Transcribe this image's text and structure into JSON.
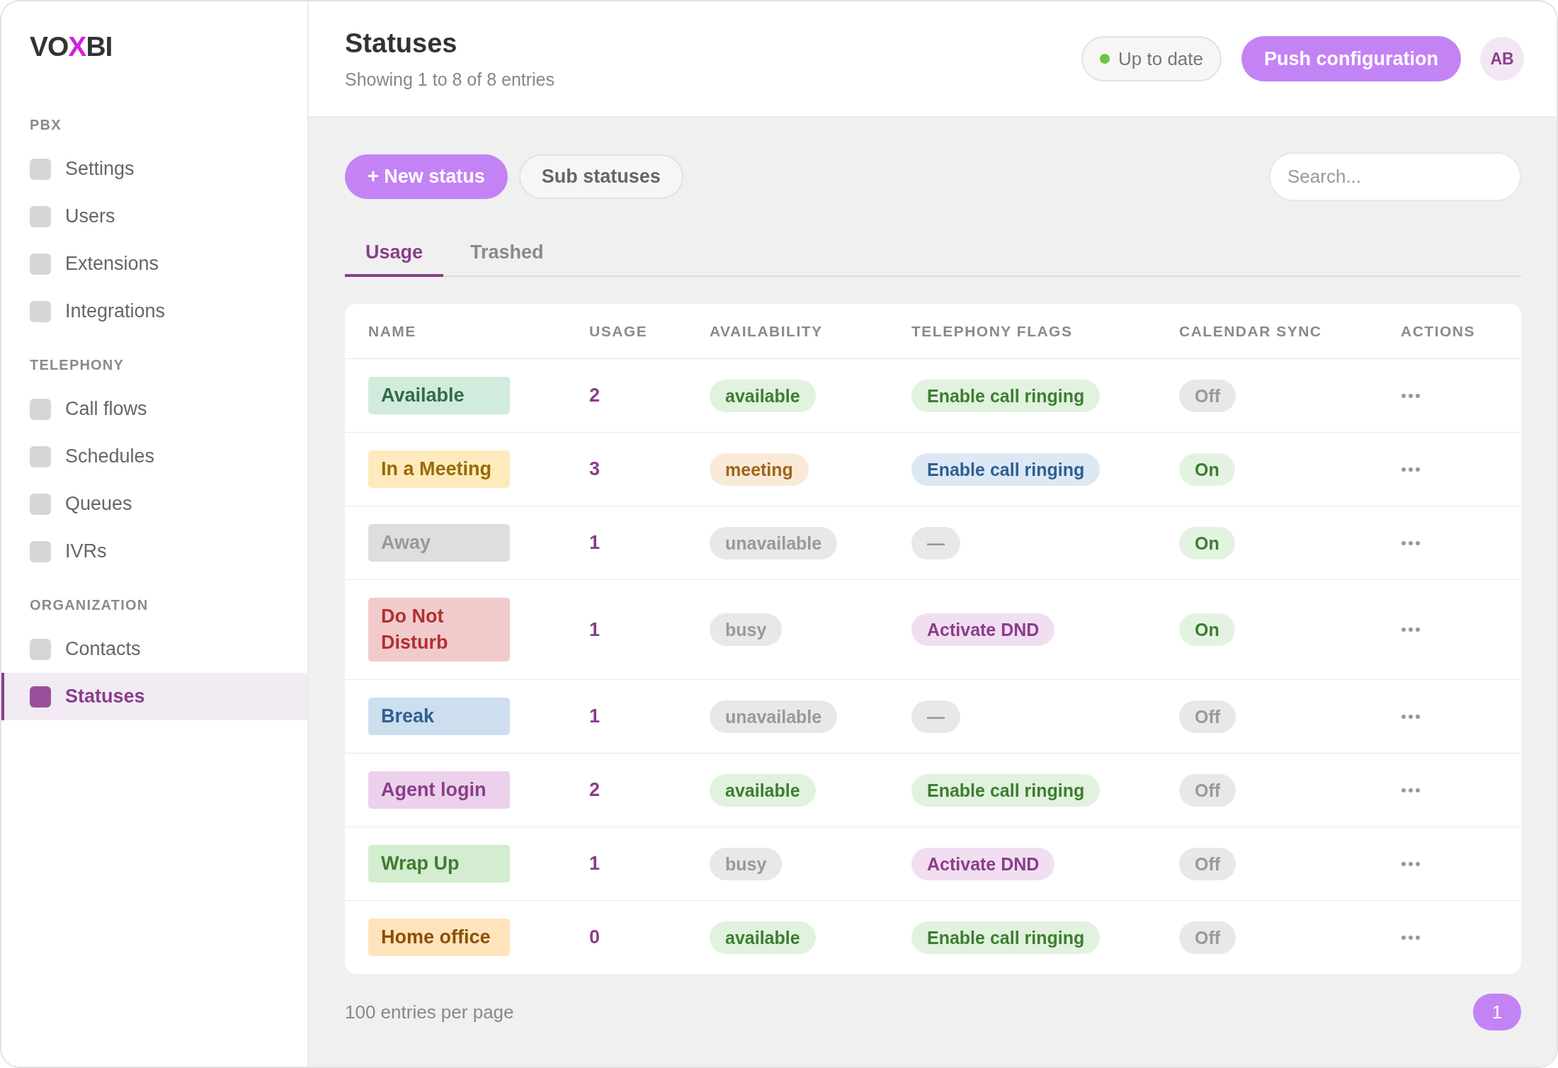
{
  "sidebar": {
    "logo": {
      "before": "VO",
      "accent": "X",
      "after": "BI"
    },
    "sections": [
      {
        "title": "PBX",
        "items": [
          {
            "label": "Settings",
            "selected": false
          },
          {
            "label": "Users",
            "selected": false
          },
          {
            "label": "Extensions",
            "selected": false
          },
          {
            "label": "Integrations",
            "selected": false
          }
        ]
      },
      {
        "title": "TELEPHONY",
        "items": [
          {
            "label": "Call flows",
            "selected": false
          },
          {
            "label": "Schedules",
            "selected": false
          },
          {
            "label": "Queues",
            "selected": false
          },
          {
            "label": "IVRs",
            "selected": false
          }
        ]
      },
      {
        "title": "ORGANIZATION",
        "items": [
          {
            "label": "Contacts",
            "selected": false
          },
          {
            "label": "Statuses",
            "selected": true
          }
        ]
      }
    ]
  },
  "header": {
    "title": "Statuses",
    "subtitle": "Showing 1 to 8 of 8 entries",
    "sync_status": {
      "text": "Up to date",
      "color": "#6bc646"
    },
    "push_button": "Push configuration",
    "avatar": "AB"
  },
  "toolbar": {
    "buttons": [
      {
        "label": "+ New status",
        "kind": "primary"
      },
      {
        "label": "Sub statuses",
        "kind": "secondary"
      }
    ],
    "search": {
      "placeholder": "Search..."
    }
  },
  "tabs": [
    {
      "label": "Usage",
      "selected": true
    },
    {
      "label": "Trashed",
      "selected": false
    }
  ],
  "table": {
    "columns": [
      "NAME",
      "USAGE",
      "AVAILABILITY",
      "TELEPHONY FLAGS",
      "CALENDAR SYNC",
      "ACTIONS"
    ],
    "rows": [
      {
        "name": {
          "text": "Available",
          "color": "#2e6b4a"
        },
        "usage": "2",
        "availability": {
          "text": "available",
          "color": "#3d7d32"
        },
        "telephony_flags": {
          "text": "Enable call ringing",
          "color": "#3d7d32"
        },
        "calendar_sync": {
          "text": "Off",
          "on": false
        }
      },
      {
        "name": {
          "text": "In a Meeting",
          "color": "#9a6a00"
        },
        "usage": "3",
        "availability": {
          "text": "meeting",
          "color": "#a0651a"
        },
        "telephony_flags": {
          "text": "Enable call ringing",
          "color": "#2f5f8f"
        },
        "calendar_sync": {
          "text": "On",
          "on": true
        }
      },
      {
        "name": {
          "text": "Away",
          "color": "#999999"
        },
        "usage": "1",
        "availability": {
          "text": "unavailable",
          "color": "#999999"
        },
        "telephony_flags": {
          "text": "—",
          "color": "#999999"
        },
        "calendar_sync": {
          "text": "On",
          "on": true
        }
      },
      {
        "name": {
          "text": "Do Not Disturb",
          "color": "#b1302f"
        },
        "usage": "1",
        "availability": {
          "text": "busy",
          "color": "#999999"
        },
        "telephony_flags": {
          "text": "Activate DND",
          "color": "#8b3d8b"
        },
        "calendar_sync": {
          "text": "On",
          "on": true
        }
      },
      {
        "name": {
          "text": "Break",
          "color": "#2f5f8f"
        },
        "usage": "1",
        "availability": {
          "text": "unavailable",
          "color": "#999999"
        },
        "telephony_flags": {
          "text": "—",
          "color": "#999999"
        },
        "calendar_sync": {
          "text": "Off",
          "on": false
        }
      },
      {
        "name": {
          "text": "Agent login",
          "color": "#8b3d8b"
        },
        "usage": "2",
        "availability": {
          "text": "available",
          "color": "#3d7d32"
        },
        "telephony_flags": {
          "text": "Enable call ringing",
          "color": "#3d7d32"
        },
        "calendar_sync": {
          "text": "Off",
          "on": false
        }
      },
      {
        "name": {
          "text": "Wrap Up",
          "color": "#3d7d32"
        },
        "usage": "1",
        "availability": {
          "text": "busy",
          "color": "#999999"
        },
        "telephony_flags": {
          "text": "Activate DND",
          "color": "#8b3d8b"
        },
        "calendar_sync": {
          "text": "Off",
          "on": false
        }
      },
      {
        "name": {
          "text": "Home office",
          "color": "#8a5000"
        },
        "usage": "0",
        "availability": {
          "text": "available",
          "color": "#3d7d32"
        },
        "telephony_flags": {
          "text": "Enable call ringing",
          "color": "#3d7d32"
        },
        "calendar_sync": {
          "text": "Off",
          "on": false
        }
      }
    ]
  },
  "footer": {
    "per_page": "100 entries per page",
    "pages": [
      {
        "label": "1",
        "selected": true
      }
    ]
  }
}
